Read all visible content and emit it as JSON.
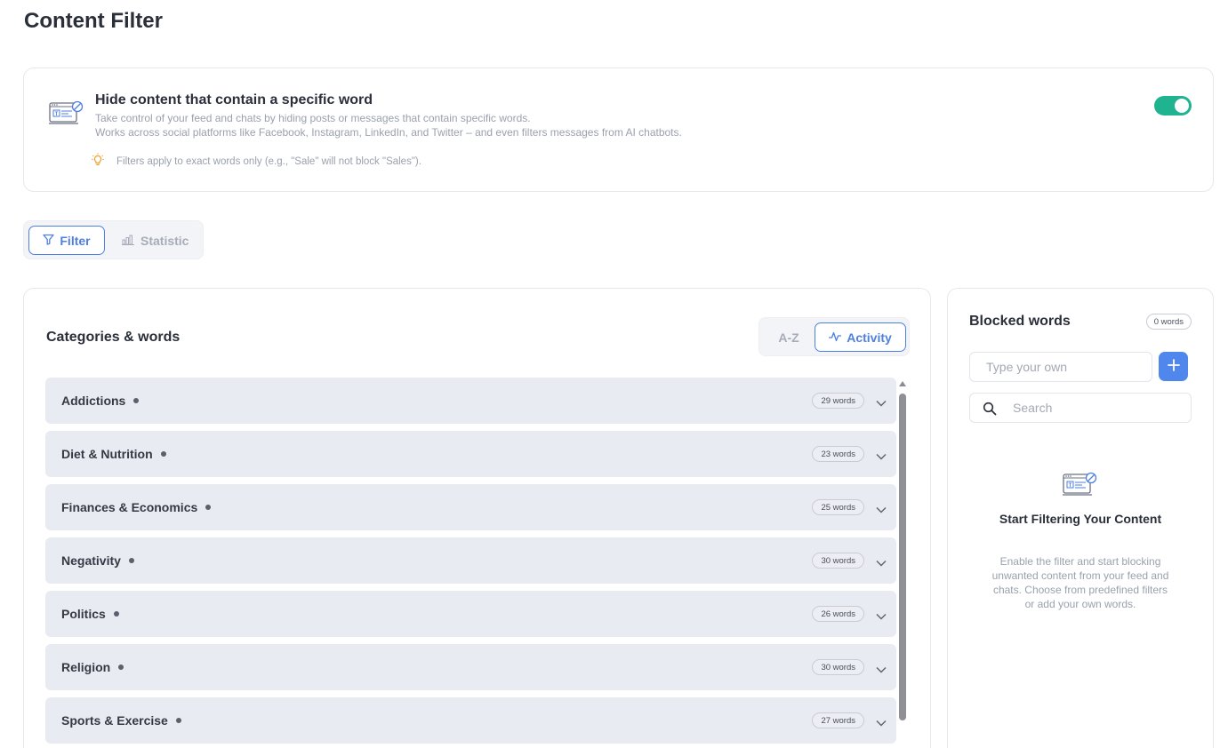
{
  "page": {
    "title": "Content Filter"
  },
  "hero": {
    "title": "Hide content that contain a specific word",
    "desc_line1": "Take control of your feed and chats by hiding posts or messages that contain specific words.",
    "desc_line2": "Works across social platforms like Facebook, Instagram, LinkedIn, and Twitter – and even filters messages from AI chatbots.",
    "tip": "Filters apply to exact words only (e.g., \"Sale\" will not block \"Sales\").",
    "toggle_on": true,
    "toggle_color": "#1fb48f"
  },
  "tabs": [
    {
      "label": "Filter",
      "icon": "filter-icon",
      "active": true
    },
    {
      "label": "Statistic",
      "icon": "bar-chart-icon",
      "active": false
    }
  ],
  "categories": {
    "title": "Categories & words",
    "sort": {
      "az_label": "A-Z",
      "activity_label": "Activity",
      "active": "activity"
    },
    "items": [
      {
        "name": "Addictions",
        "count": "29 words"
      },
      {
        "name": "Diet & Nutrition",
        "count": "23 words"
      },
      {
        "name": "Finances & Economics",
        "count": "25 words"
      },
      {
        "name": "Negativity",
        "count": "30 words"
      },
      {
        "name": "Politics",
        "count": "26 words"
      },
      {
        "name": "Religion",
        "count": "30 words"
      },
      {
        "name": "Sports & Exercise",
        "count": "27 words"
      }
    ]
  },
  "blocked": {
    "title": "Blocked words",
    "count": "0 words",
    "input_placeholder": "Type your own",
    "search_placeholder": "Search",
    "empty_title": "Start Filtering Your Content",
    "empty_desc": "Enable the filter and start blocking unwanted content from your feed and chats. Choose from predefined filters or add your own words."
  },
  "colors": {
    "accent": "#4f7fe0",
    "add_button": "#4f87ec",
    "row_bg": "#e9ebf2",
    "tip_icon": "#f0a030"
  }
}
